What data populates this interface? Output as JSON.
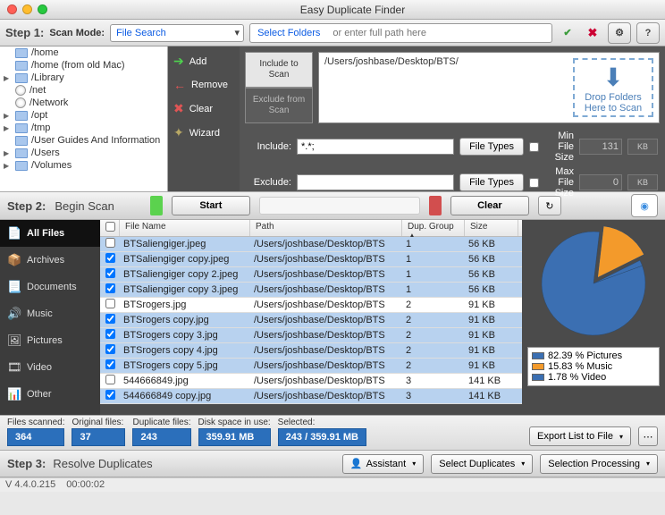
{
  "window": {
    "title": "Easy Duplicate Finder"
  },
  "step1": {
    "label": "Step 1:",
    "scan_mode_label": "Scan Mode:",
    "scan_mode_value": "File Search",
    "select_folders_btn": "Select Folders",
    "path_placeholder": "or enter full path here",
    "tree": [
      {
        "icon": "folder",
        "label": "/home",
        "expandable": false
      },
      {
        "icon": "folder",
        "label": "/home (from old Mac)",
        "expandable": false
      },
      {
        "icon": "folder",
        "label": "/Library",
        "expandable": true
      },
      {
        "icon": "disk",
        "label": "/net",
        "expandable": false
      },
      {
        "icon": "disk",
        "label": "/Network",
        "expandable": false
      },
      {
        "icon": "folder",
        "label": "/opt",
        "expandable": true
      },
      {
        "icon": "folder",
        "label": "/tmp",
        "expandable": true
      },
      {
        "icon": "folder",
        "label": "/User Guides And Information",
        "expandable": false
      },
      {
        "icon": "folder",
        "label": "/Users",
        "expandable": true
      },
      {
        "icon": "folder",
        "label": "/Volumes",
        "expandable": true
      }
    ],
    "actions": {
      "add": "Add",
      "remove": "Remove",
      "clear": "Clear",
      "wizard": "Wizard"
    },
    "include_tab": "Include to\nScan",
    "exclude_tab": "Exclude from\nScan",
    "scan_path": "/Users/joshbase/Desktop/BTS/",
    "drop_hint": "Drop Folders\nHere to Scan",
    "include_label": "Include:",
    "exclude_label": "Exclude:",
    "include_pattern": "*.*;",
    "exclude_pattern": "",
    "file_types_btn": "File Types",
    "min_size_label": "Min File Size",
    "max_size_label": "Max File Size",
    "min_size_val": "131",
    "max_size_val": "0",
    "size_unit": "KB"
  },
  "step2": {
    "label": "Step 2:",
    "title": "Begin Scan",
    "start_btn": "Start",
    "clear_btn": "Clear",
    "categories": [
      {
        "icon": "📄",
        "label": "All Files",
        "active": true
      },
      {
        "icon": "📦",
        "label": "Archives"
      },
      {
        "icon": "📃",
        "label": "Documents"
      },
      {
        "icon": "🔊",
        "label": "Music"
      },
      {
        "icon": "🖼",
        "label": "Pictures"
      },
      {
        "icon": "🎞",
        "label": "Video"
      },
      {
        "icon": "📊",
        "label": "Other"
      }
    ],
    "columns": {
      "file_name": "File Name",
      "path": "Path",
      "dup_group": "Dup. Group ▲",
      "size": "Size"
    },
    "rows": [
      {
        "checked": false,
        "name": "BTSaliengiger.jpeg",
        "path": "/Users/joshbase/Desktop/BTS",
        "group": "1",
        "size": "56 KB",
        "selected": true
      },
      {
        "checked": true,
        "name": "BTSaliengiger copy.jpeg",
        "path": "/Users/joshbase/Desktop/BTS",
        "group": "1",
        "size": "56 KB",
        "selected": true
      },
      {
        "checked": true,
        "name": "BTSaliengiger copy 2.jpeg",
        "path": "/Users/joshbase/Desktop/BTS",
        "group": "1",
        "size": "56 KB",
        "selected": true
      },
      {
        "checked": true,
        "name": "BTSaliengiger copy 3.jpeg",
        "path": "/Users/joshbase/Desktop/BTS",
        "group": "1",
        "size": "56 KB",
        "selected": true
      },
      {
        "checked": false,
        "name": "BTSrogers.jpg",
        "path": "/Users/joshbase/Desktop/BTS",
        "group": "2",
        "size": "91 KB",
        "selected": false
      },
      {
        "checked": true,
        "name": "BTSrogers copy.jpg",
        "path": "/Users/joshbase/Desktop/BTS",
        "group": "2",
        "size": "91 KB",
        "selected": true
      },
      {
        "checked": true,
        "name": "BTSrogers copy 3.jpg",
        "path": "/Users/joshbase/Desktop/BTS",
        "group": "2",
        "size": "91 KB",
        "selected": true
      },
      {
        "checked": true,
        "name": "BTSrogers copy 4.jpg",
        "path": "/Users/joshbase/Desktop/BTS",
        "group": "2",
        "size": "91 KB",
        "selected": true
      },
      {
        "checked": true,
        "name": "BTSrogers copy 5.jpg",
        "path": "/Users/joshbase/Desktop/BTS",
        "group": "2",
        "size": "91 KB",
        "selected": true
      },
      {
        "checked": false,
        "name": "544666849.jpg",
        "path": "/Users/joshbase/Desktop/BTS",
        "group": "3",
        "size": "141 KB",
        "selected": false
      },
      {
        "checked": true,
        "name": "544666849 copy.jpg",
        "path": "/Users/joshbase/Desktop/BTS",
        "group": "3",
        "size": "141 KB",
        "selected": true
      }
    ]
  },
  "chart_data": {
    "type": "pie",
    "title": "",
    "series": [
      {
        "name": "Pictures",
        "value": 82.39,
        "color": "#3b6fb2"
      },
      {
        "name": "Music",
        "value": 15.83,
        "color": "#f39a2b"
      },
      {
        "name": "Video",
        "value": 1.78,
        "color": "#3b6fb2"
      }
    ],
    "legend": [
      "82.39 % Pictures",
      "15.83 % Music",
      "1.78 % Video"
    ],
    "legend_colors": [
      "#3b6fb2",
      "#f39a2b",
      "#3b6fb2"
    ]
  },
  "stats": {
    "scanned_label": "Files scanned:",
    "scanned": "364",
    "original_label": "Original files:",
    "original": "37",
    "dup_label": "Duplicate files:",
    "dup": "243",
    "disk_label": "Disk space in use:",
    "disk": "359.91 MB",
    "selected_label": "Selected:",
    "selected": "243 / 359.91 MB",
    "export_btn": "Export List to File"
  },
  "step3": {
    "label": "Step 3:",
    "title": "Resolve Duplicates",
    "assistant_btn": "Assistant",
    "select_dup_btn": "Select Duplicates",
    "sel_proc_btn": "Selection Processing"
  },
  "footer": {
    "version": "V 4.4.0.215",
    "time": "00:00:02"
  }
}
